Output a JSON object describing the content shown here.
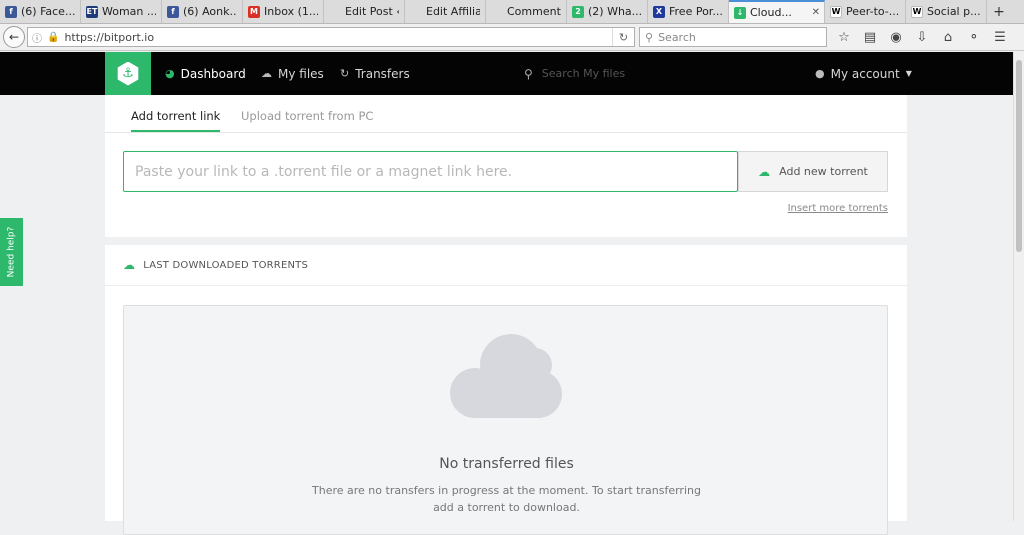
{
  "browser": {
    "tabs": [
      {
        "label": "(6) Face...",
        "icon": "facebook-icon",
        "color": "#3b5998",
        "glyph": "f"
      },
      {
        "label": "Woman ...",
        "icon": "et-icon",
        "color": "#1f3a7a",
        "glyph": "ET"
      },
      {
        "label": "(6) Aonk...",
        "icon": "facebook-icon",
        "color": "#3b5998",
        "glyph": "f"
      },
      {
        "label": "Inbox (1...",
        "icon": "gmail-icon",
        "color": "#d93025",
        "glyph": "M"
      },
      {
        "label": "Edit Post ‹ ...",
        "icon": "",
        "color": "",
        "glyph": ""
      },
      {
        "label": "Edit Affiliat...",
        "icon": "",
        "color": "",
        "glyph": ""
      },
      {
        "label": "Comments ...",
        "icon": "",
        "color": "",
        "glyph": ""
      },
      {
        "label": "(2) Wha...",
        "icon": "whatsapp-icon",
        "color": "#2db86b",
        "glyph": "2"
      },
      {
        "label": "Free Por...",
        "icon": "x-icon",
        "color": "#1f3a9a",
        "glyph": "X"
      },
      {
        "label": "Cloud...",
        "icon": "bitport-icon",
        "color": "#2db86b",
        "glyph": "↓"
      },
      {
        "label": "Peer-to-...",
        "icon": "wikipedia-icon",
        "color": "#ffffff",
        "glyph": "W"
      },
      {
        "label": "Social p...",
        "icon": "wikipedia-icon",
        "color": "#ffffff",
        "glyph": "W"
      }
    ],
    "active_tab": 9,
    "url": "https://bitport.io",
    "search_placeholder": "Search"
  },
  "site": {
    "nav": {
      "dashboard": "Dashboard",
      "my_files": "My files",
      "transfers": "Transfers"
    },
    "search_placeholder": "Search My files",
    "account": "My account",
    "accent": "#2db86b"
  },
  "add": {
    "tab_link": "Add torrent link",
    "tab_upload": "Upload torrent from PC",
    "input_placeholder": "Paste your link to a .torrent file or a magnet link here.",
    "button": "Add new torrent",
    "more_link": "Insert more torrents"
  },
  "last": {
    "header": "LAST DOWNLOADED TORRENTS",
    "empty_title": "No transferred files",
    "empty_line1": "There are no transfers in progress at the moment. To start transferring",
    "empty_line2": "add a torrent to download."
  },
  "help": "Need help?"
}
